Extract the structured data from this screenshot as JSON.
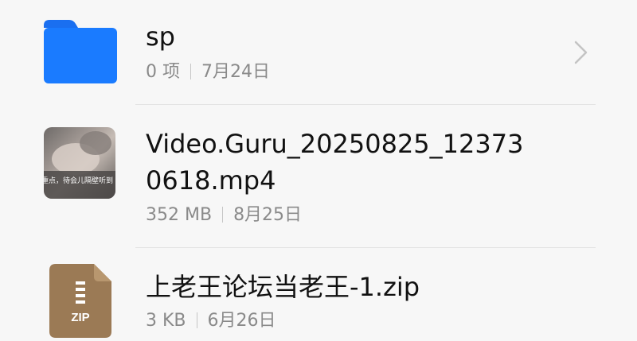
{
  "files": [
    {
      "name": "sp",
      "count": "0 项",
      "date": "7月24日",
      "icon": "folder-icon"
    },
    {
      "name_line1": "Video.Guru_20250825_12373",
      "name_line2": "0618.mp4",
      "size": "352 MB",
      "date": "8月25日",
      "icon": "video-thumbnail",
      "thumb_caption": "重点，待会儿隔壁听到"
    },
    {
      "name": "上老王论坛当老王-1.zip",
      "size": "3 KB",
      "date": "6月26日",
      "icon": "zip-file-icon",
      "icon_label": "ZIP"
    }
  ],
  "colors": {
    "folder": "#1a7bff",
    "zip": "#9b7a55"
  }
}
